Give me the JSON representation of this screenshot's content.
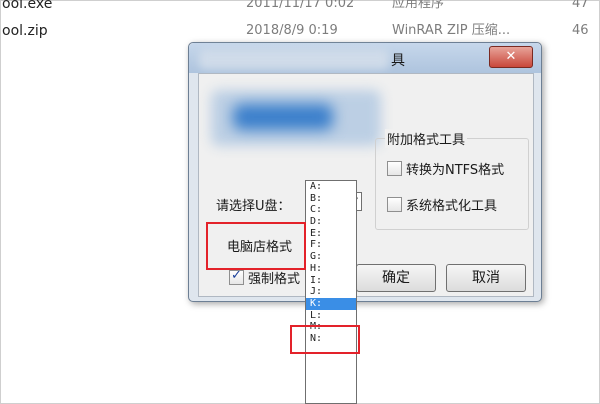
{
  "files": [
    {
      "name": "ool.exe",
      "date": "2011/11/17 0:02",
      "type": "应用程序",
      "size": "47"
    },
    {
      "name": "ool.zip",
      "date": "2018/8/9 0:19",
      "type": "WinRAR ZIP 压缩...",
      "size": "46"
    }
  ],
  "dialog": {
    "title_suffix": "具",
    "close_label": "✕",
    "addon_group_label": "附加格式工具",
    "ntfs_label": "转换为NTFS格式",
    "sysformat_label": "系统格式化工具",
    "udisk_label": "请选择U盘：",
    "udisk_value": "A:",
    "shop_group_label": "电脑店格式",
    "force_label": "强制格式",
    "force_checked": true,
    "ok_label": "确定",
    "cancel_label": "取消"
  },
  "drive_options": [
    "A:",
    "B:",
    "C:",
    "D:",
    "E:",
    "F:",
    "G:",
    "H:",
    "I:",
    "J:",
    "K:",
    "L:",
    "M:",
    "N:"
  ],
  "selected_drive": "K:",
  "colors": {
    "highlight": "#e3222a",
    "selection": "#3a8ee6"
  }
}
